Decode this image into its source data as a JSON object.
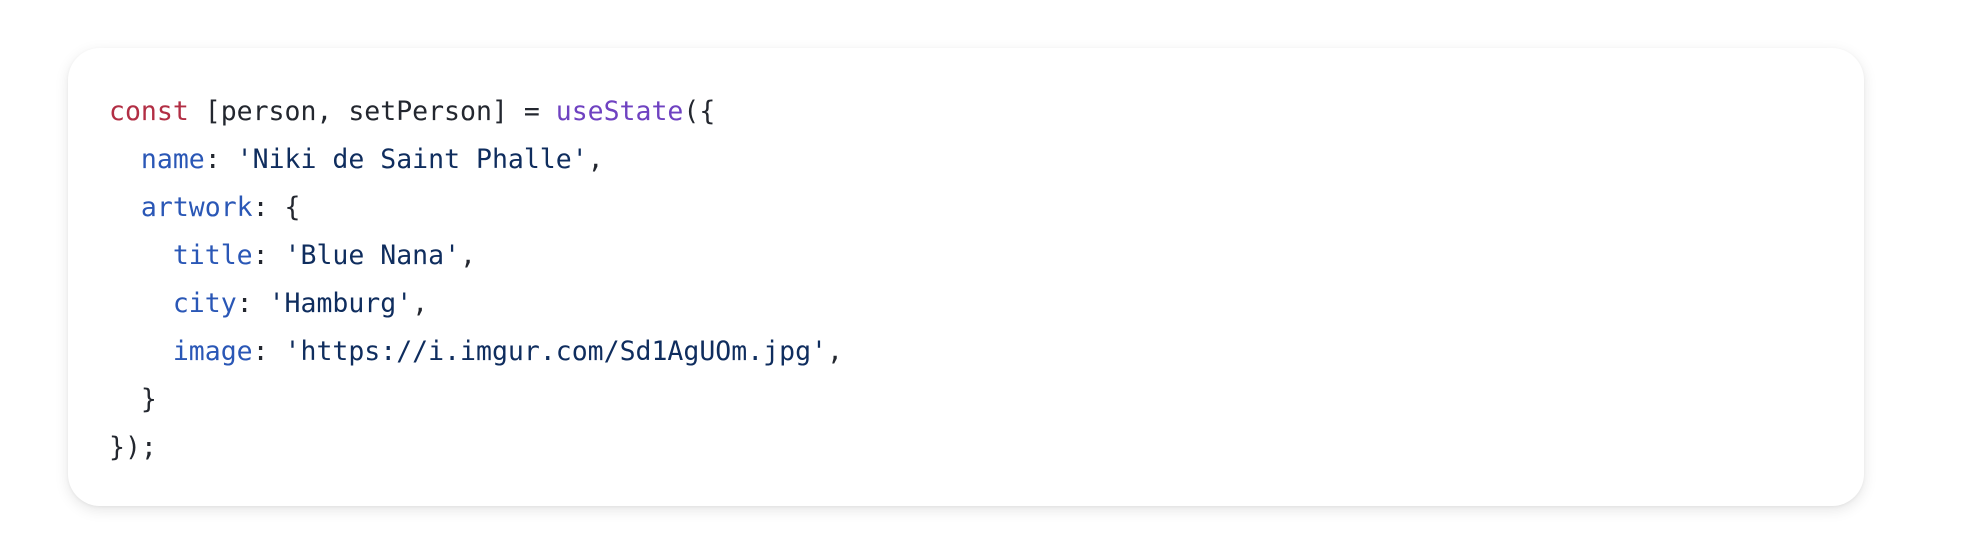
{
  "code_block": {
    "lines": [
      {
        "tokens": [
          {
            "type": "keyword",
            "text": "const"
          },
          {
            "type": "punct",
            "text": " [person, setPerson] = "
          },
          {
            "type": "func",
            "text": "useState"
          },
          {
            "type": "punct",
            "text": "({"
          }
        ]
      },
      {
        "tokens": [
          {
            "type": "punct",
            "text": "  "
          },
          {
            "type": "prop",
            "text": "name"
          },
          {
            "type": "punct",
            "text": ": "
          },
          {
            "type": "string",
            "text": "'Niki de Saint Phalle'"
          },
          {
            "type": "punct",
            "text": ","
          }
        ]
      },
      {
        "tokens": [
          {
            "type": "punct",
            "text": "  "
          },
          {
            "type": "prop",
            "text": "artwork"
          },
          {
            "type": "punct",
            "text": ": {"
          }
        ]
      },
      {
        "tokens": [
          {
            "type": "punct",
            "text": "    "
          },
          {
            "type": "prop",
            "text": "title"
          },
          {
            "type": "punct",
            "text": ": "
          },
          {
            "type": "string",
            "text": "'Blue Nana'"
          },
          {
            "type": "punct",
            "text": ","
          }
        ]
      },
      {
        "tokens": [
          {
            "type": "punct",
            "text": "    "
          },
          {
            "type": "prop",
            "text": "city"
          },
          {
            "type": "punct",
            "text": ": "
          },
          {
            "type": "string",
            "text": "'Hamburg'"
          },
          {
            "type": "punct",
            "text": ","
          }
        ]
      },
      {
        "tokens": [
          {
            "type": "punct",
            "text": "    "
          },
          {
            "type": "prop",
            "text": "image"
          },
          {
            "type": "punct",
            "text": ": "
          },
          {
            "type": "string",
            "text": "'https://i.imgur.com/Sd1AgUOm.jpg'"
          },
          {
            "type": "punct",
            "text": ","
          }
        ]
      },
      {
        "tokens": [
          {
            "type": "punct",
            "text": "  }"
          }
        ]
      },
      {
        "tokens": [
          {
            "type": "punct",
            "text": "});"
          }
        ]
      }
    ]
  },
  "colors": {
    "keyword": "#b22e44",
    "function": "#6f42c1",
    "property": "#2a57b6",
    "string": "#0f2d5e",
    "text": "#23272f",
    "background": "#ffffff"
  }
}
